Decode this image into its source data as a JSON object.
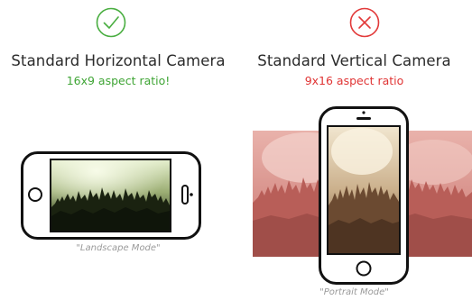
{
  "left_panel": {
    "title": "Standard Horizontal Camera",
    "subtitle": "16x9 aspect ratio!",
    "subtitle_color": "#3fa535",
    "caption": "\"Landscape Mode\"",
    "status_icon": "check-circle-icon"
  },
  "right_panel": {
    "title": "Standard Vertical Camera",
    "subtitle": "9x16 aspect ratio",
    "subtitle_color": "#e03434",
    "caption": "\"Portrait Mode\"",
    "status_icon": "x-circle-icon"
  },
  "colors": {
    "check": "#4aae41",
    "cross": "#e23a3a",
    "phone_frame": "#111111",
    "crop_overlay": "#d98a85"
  }
}
